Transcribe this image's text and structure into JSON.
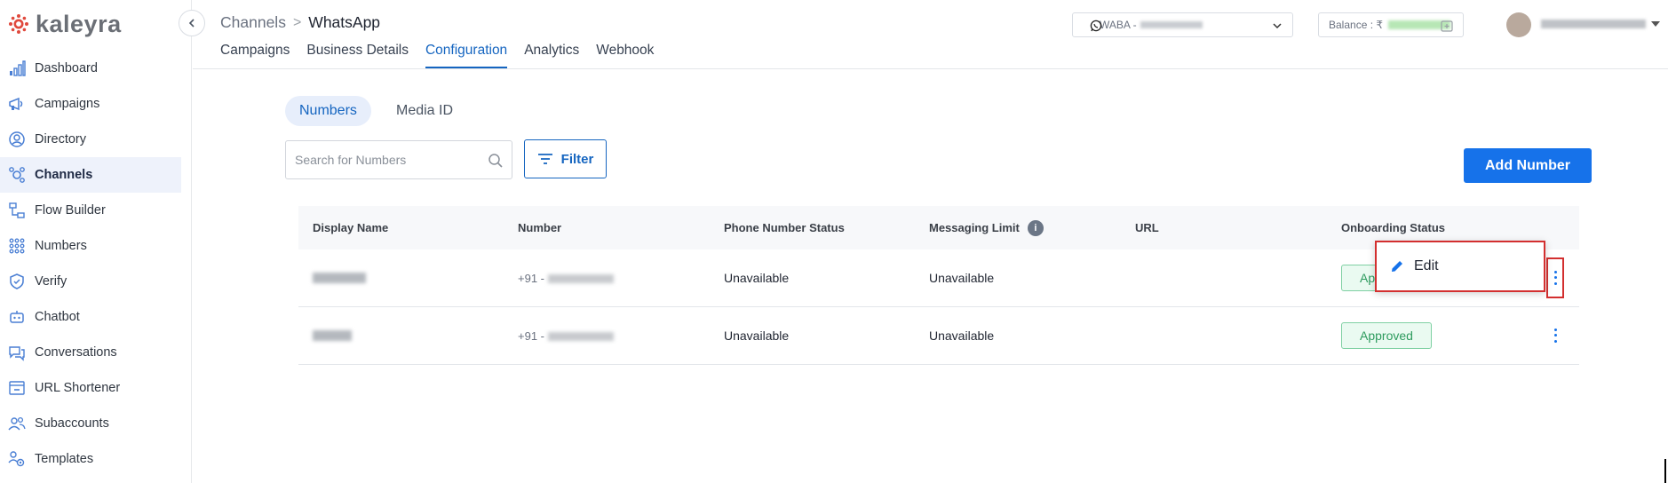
{
  "brand": {
    "name": "kaleyra"
  },
  "sidebar": {
    "items": [
      {
        "label": "Dashboard",
        "icon": "chart-bars-icon"
      },
      {
        "label": "Campaigns",
        "icon": "megaphone-icon"
      },
      {
        "label": "Directory",
        "icon": "user-circle-icon"
      },
      {
        "label": "Channels",
        "icon": "channels-icon",
        "active": true
      },
      {
        "label": "Flow Builder",
        "icon": "flow-icon"
      },
      {
        "label": "Numbers",
        "icon": "dial-pad-icon"
      },
      {
        "label": "Verify",
        "icon": "shield-check-icon"
      },
      {
        "label": "Chatbot",
        "icon": "chatbot-icon"
      },
      {
        "label": "Conversations",
        "icon": "chat-bubbles-icon"
      },
      {
        "label": "URL Shortener",
        "icon": "link-window-icon"
      },
      {
        "label": "Subaccounts",
        "icon": "users-icon"
      },
      {
        "label": "Templates",
        "icon": "template-gear-icon"
      }
    ]
  },
  "header": {
    "breadcrumb": {
      "parent": "Channels",
      "separator": ">",
      "current": "WhatsApp"
    },
    "tabs": [
      "Campaigns",
      "Business Details",
      "Configuration",
      "Analytics",
      "Webhook"
    ],
    "active_tab": "Configuration",
    "waba_label": "WABA -",
    "balance_label": "Balance : ₹"
  },
  "content": {
    "segments": [
      "Numbers",
      "Media ID"
    ],
    "search_placeholder": "Search for Numbers",
    "filter_label": "Filter",
    "add_button_label": "Add Number",
    "table": {
      "columns": [
        "Display Name",
        "Number",
        "Phone Number Status",
        "Messaging Limit",
        "URL",
        "Onboarding Status"
      ],
      "rows": [
        {
          "number_prefix": "+91 -",
          "phone_status": "Unavailable",
          "messaging_limit": "Unavailable",
          "url": "",
          "onboarding_status": "Approved"
        },
        {
          "number_prefix": "+91 -",
          "phone_status": "Unavailable",
          "messaging_limit": "Unavailable",
          "url": "",
          "onboarding_status": "Approved"
        }
      ]
    },
    "context_menu": {
      "edit_label": "Edit"
    }
  },
  "colors": {
    "accent": "#1565c0",
    "primary_button": "#1672ea",
    "approved_text": "#2e9b5e",
    "approved_bg": "#eafaf1",
    "highlight": "#d32f2f",
    "logo_red": "#e0493d"
  }
}
